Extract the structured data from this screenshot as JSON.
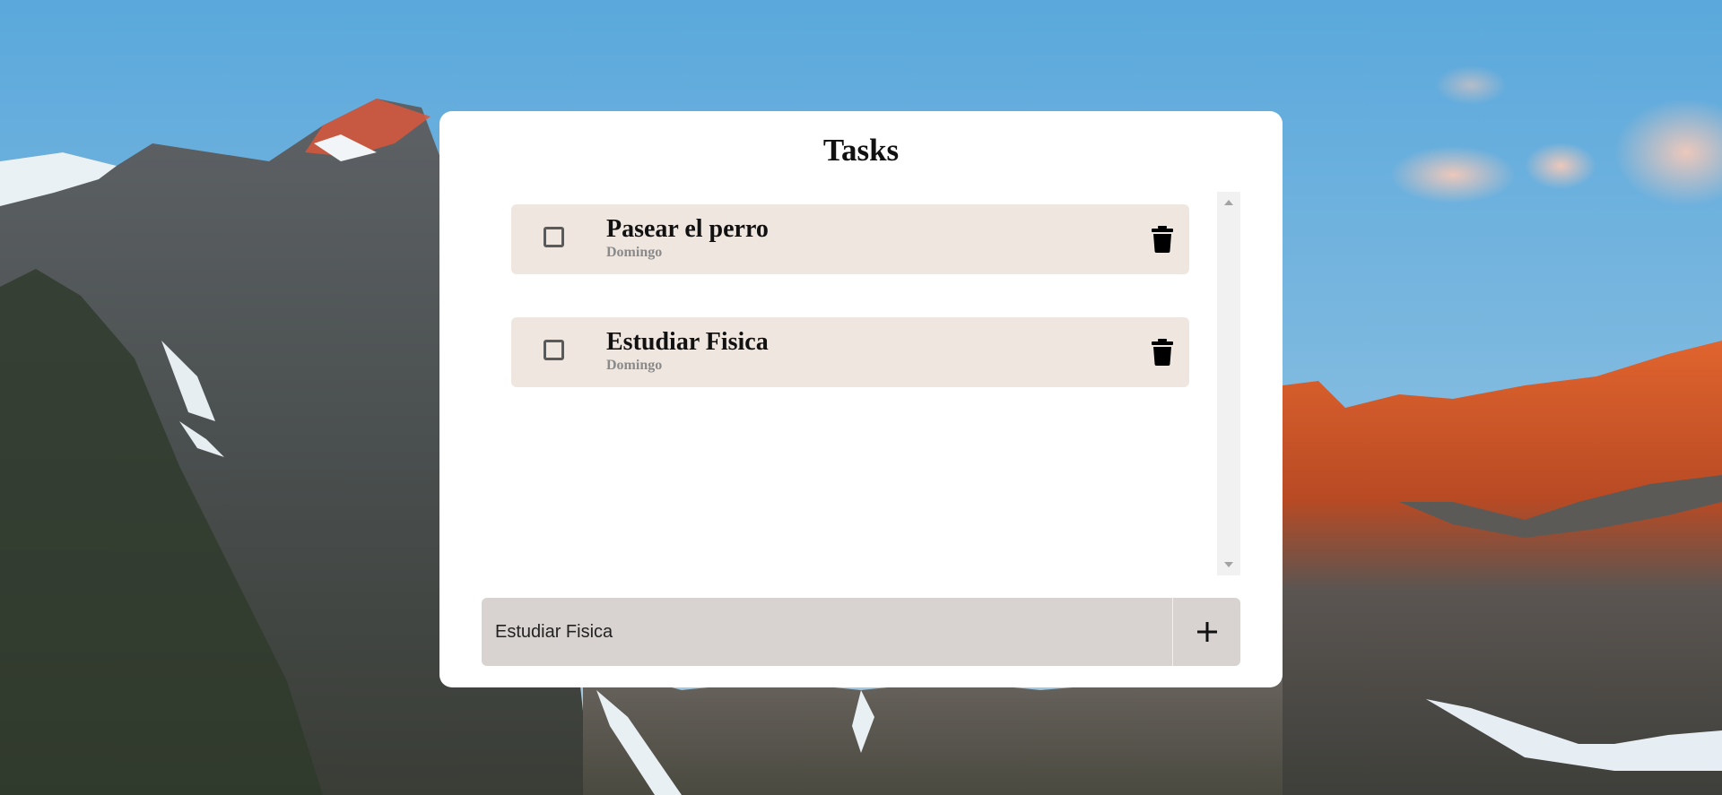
{
  "app": {
    "title": "Tasks"
  },
  "tasks": [
    {
      "name": "Pasear el perro",
      "day": "Domingo",
      "done": false
    },
    {
      "name": "Estudiar Fisica",
      "day": "Domingo",
      "done": false
    }
  ],
  "input": {
    "value": "Estudiar Fisica",
    "add_icon": "plus-icon"
  },
  "icons": {
    "checkbox": "checkbox-icon",
    "delete": "trash-icon",
    "scroll_up": "triangle-up-icon",
    "scroll_down": "triangle-down-icon"
  },
  "colors": {
    "card_background": "#ffffff",
    "task_background": "#efe6e0",
    "input_background": "#d8d3d0",
    "secondary_text": "#8a8a8a",
    "scrollbar_track": "#f1f1f1"
  }
}
